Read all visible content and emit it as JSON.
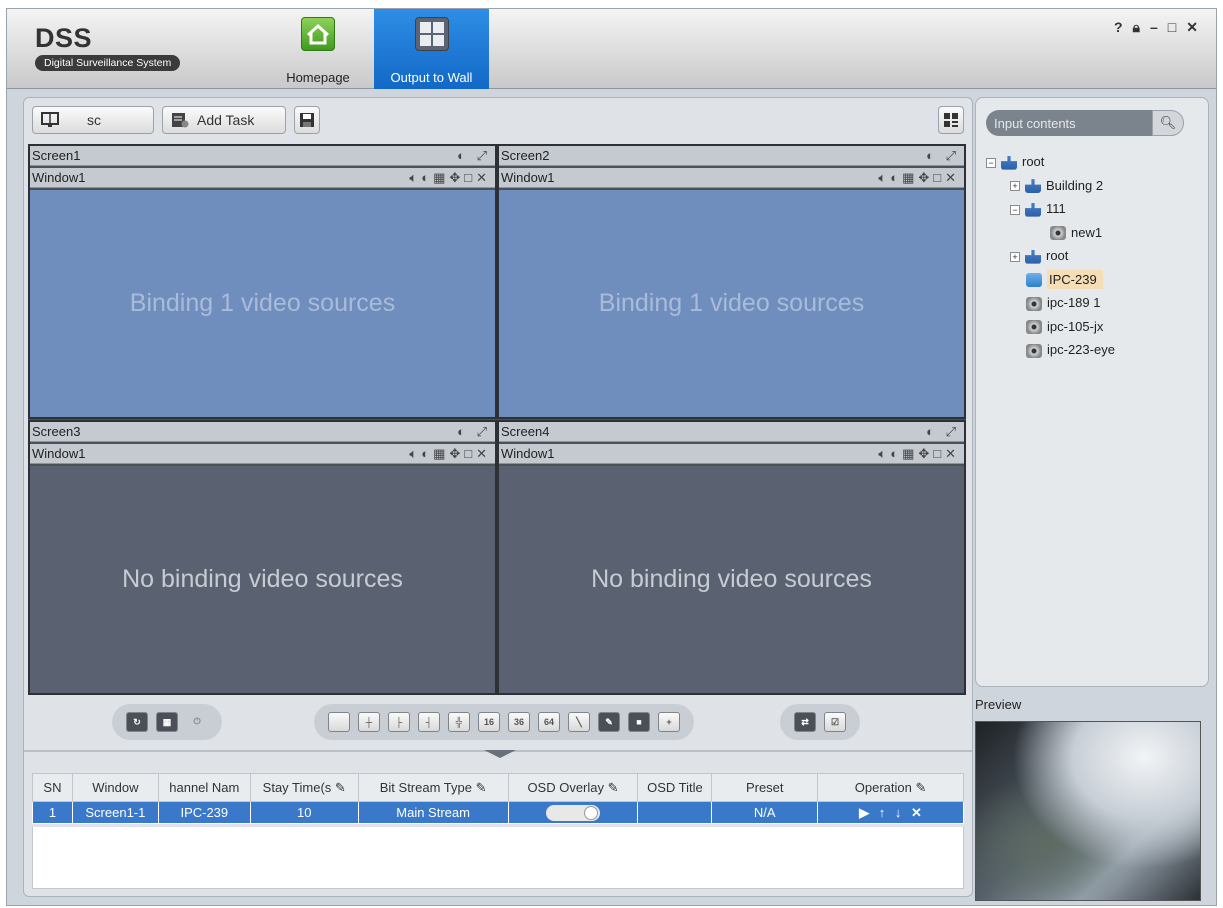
{
  "app": {
    "brand": "DSS",
    "subtitle": "Digital Surveillance System",
    "tabs": [
      {
        "label": "Homepage",
        "icon": "home-icon"
      },
      {
        "label": "Output to Wall",
        "icon": "video-wall-icon",
        "active": true
      }
    ],
    "window_controls": [
      "?",
      "lock",
      "minimize",
      "maximize",
      "close"
    ]
  },
  "toolbar": {
    "wall_select": "sc",
    "add_task": "Add Task"
  },
  "wall": {
    "screens": [
      {
        "title": "Screen1",
        "window": "Window1",
        "status": "Binding 1 video sources",
        "bound": true
      },
      {
        "title": "Screen2",
        "window": "Window1",
        "status": "Binding 1 video sources",
        "bound": true
      },
      {
        "title": "Screen3",
        "window": "Window1",
        "status": "No binding video sources",
        "bound": false
      },
      {
        "title": "Screen4",
        "window": "Window1",
        "status": "No binding video sources",
        "bound": false
      }
    ]
  },
  "layout_buttons": [
    "16",
    "36",
    "64"
  ],
  "table": {
    "headers": [
      "SN",
      "Window",
      "hannel Nam",
      "Stay Time(s",
      "Bit Stream Type",
      "OSD Overlay",
      "OSD Title",
      "Preset",
      "Operation"
    ],
    "rows": [
      {
        "sn": "1",
        "window": "Screen1-1",
        "channel": "IPC-239",
        "stay": "10",
        "stream": "Main Stream",
        "osd_title": "",
        "preset": "N/A"
      }
    ]
  },
  "search": {
    "placeholder": "Input contents"
  },
  "tree": [
    {
      "label": "root",
      "level": 0,
      "expander": "-",
      "icon": "org-root-icon"
    },
    {
      "label": "Building 2",
      "level": 1,
      "expander": "+",
      "icon": "org-icon"
    },
    {
      "label": "111",
      "level": 1,
      "expander": "-",
      "icon": "org-icon"
    },
    {
      "label": "new1",
      "level": 2,
      "expander": "",
      "icon": "camera-icon"
    },
    {
      "label": "root",
      "level": 1,
      "expander": "+",
      "icon": "org-icon"
    },
    {
      "label": "IPC-239",
      "level": 1,
      "expander": "",
      "icon": "camera-online-icon",
      "selected": true
    },
    {
      "label": "ipc-189 1",
      "level": 1,
      "expander": "",
      "icon": "camera-icon"
    },
    {
      "label": "ipc-105-jx",
      "level": 1,
      "expander": "",
      "icon": "camera-icon"
    },
    {
      "label": "ipc-223-eye",
      "level": 1,
      "expander": "",
      "icon": "camera-icon"
    }
  ],
  "preview": {
    "label": "Preview"
  },
  "colors": {
    "accent": "#1a73d1",
    "bound_window": "#6f8ebe",
    "unbound_window": "#5a6170",
    "selected_row": "#3a78c9"
  }
}
